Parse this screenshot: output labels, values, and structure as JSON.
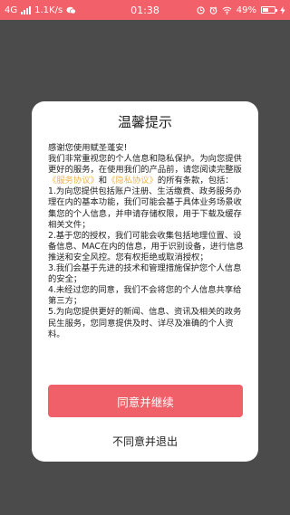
{
  "status_bar": {
    "network": "4G",
    "speed": "1.1K/s",
    "time": "01:38",
    "battery": "49%",
    "battery_fraction": 0.49,
    "icons": [
      "signal-icon",
      "wechat-icon",
      "clock-icon",
      "alarm-icon",
      "wifi-icon",
      "battery-icon",
      "lightning-icon"
    ]
  },
  "dialog": {
    "title": "温馨提示",
    "greeting": "感谢您使用赋圣蓬安!",
    "intro_1": "我们非常重视您的个人信息和隐私保护。为向您提供更好的服务，在使用我们的产品前，请您阅读完整版",
    "link_service": "《服务协议》",
    "and": "和",
    "link_privacy": "《隐私协议》",
    "intro_2": "的所有条款，包括：",
    "items": [
      "1.为向您提供包括账户注册、生活缴费、政务服务办理在内的基本功能，我们可能会基于具体业务场景收集您的个人信息，并申请存储权限，用于下载及缓存相关文件；",
      "2.基于您的授权，我们可能会收集包括地理位置、设备信息、MAC在内的信息，用于识别设备，进行信息推送和安全风控。您有权拒绝或取消授权；",
      "3.我们会基于先进的技术和管理措施保护您个人信息的安全；",
      "4.未经过您的同意，我们不会将您的个人信息共享给第三方；",
      "5.为向您提供更好的新闻、信息、资讯及相关的政务民生服务，您同意提供及时、详尽及准确的个人资料。"
    ],
    "agree_label": "同意并继续",
    "disagree_label": "不同意并退出"
  },
  "colors": {
    "accent": "#ef6068",
    "link": "#f0b34a",
    "status_bar": "#f2606a",
    "overlay": "#4b4b4b"
  }
}
